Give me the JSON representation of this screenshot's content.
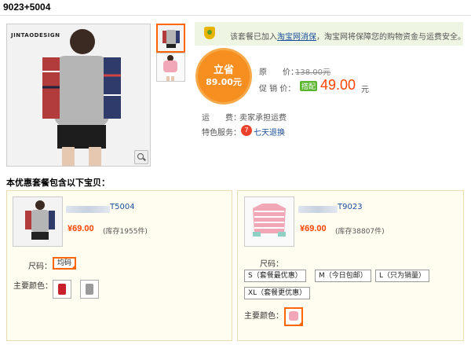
{
  "page": {
    "title": "9023+5004"
  },
  "gallery": {
    "brand_name": "JINTAODESIGN",
    "zoom_icon": "magnifier-icon",
    "thumbnails": [
      "gray-plaid-top",
      "pink-striped-top"
    ]
  },
  "notice": {
    "prefix": "该套餐已加入",
    "link": "淘宝网消保",
    "suffix": "，淘宝网将保障您的购物资金与运费安全。"
  },
  "savings": {
    "line1": "立省",
    "line2": "89.00元"
  },
  "price": {
    "original_label": "原　　价：",
    "original_value": "138.00元",
    "promo_label": "促 销 价：",
    "promo_tag": "搭配",
    "promo_value": "49.00",
    "promo_unit": "元"
  },
  "shipping": {
    "label": "运　　费：",
    "value": "卖家承担运费"
  },
  "service": {
    "label": "特色服务：",
    "icon_text": "7",
    "value": "七天退换"
  },
  "section_title": "本优惠套餐包含以下宝贝：",
  "products": [
    {
      "title_suffix": "T5004",
      "price": "¥69.00",
      "stock": "(库存1955件)",
      "size_label": "尺码：",
      "sizes": [
        "均码"
      ],
      "color_label": "主要颜色：",
      "colors": [
        "red",
        "gray"
      ]
    },
    {
      "title_suffix": "T9023",
      "price": "¥69.00",
      "stock": "(库存38807件)",
      "size_label": "尺码：",
      "sizes": [
        "S（套餐最优惠）",
        "M（今日包邮）",
        "L（只为销量）",
        "XL（套餐更优惠）"
      ],
      "color_label": "主要颜色：",
      "colors": [
        "pink"
      ]
    }
  ],
  "colors": {
    "accent": "#ff6600",
    "price": "#ff4400",
    "link": "#1a4d9c",
    "notice_bg": "#eef6e3",
    "card_bg": "#fffdef"
  }
}
